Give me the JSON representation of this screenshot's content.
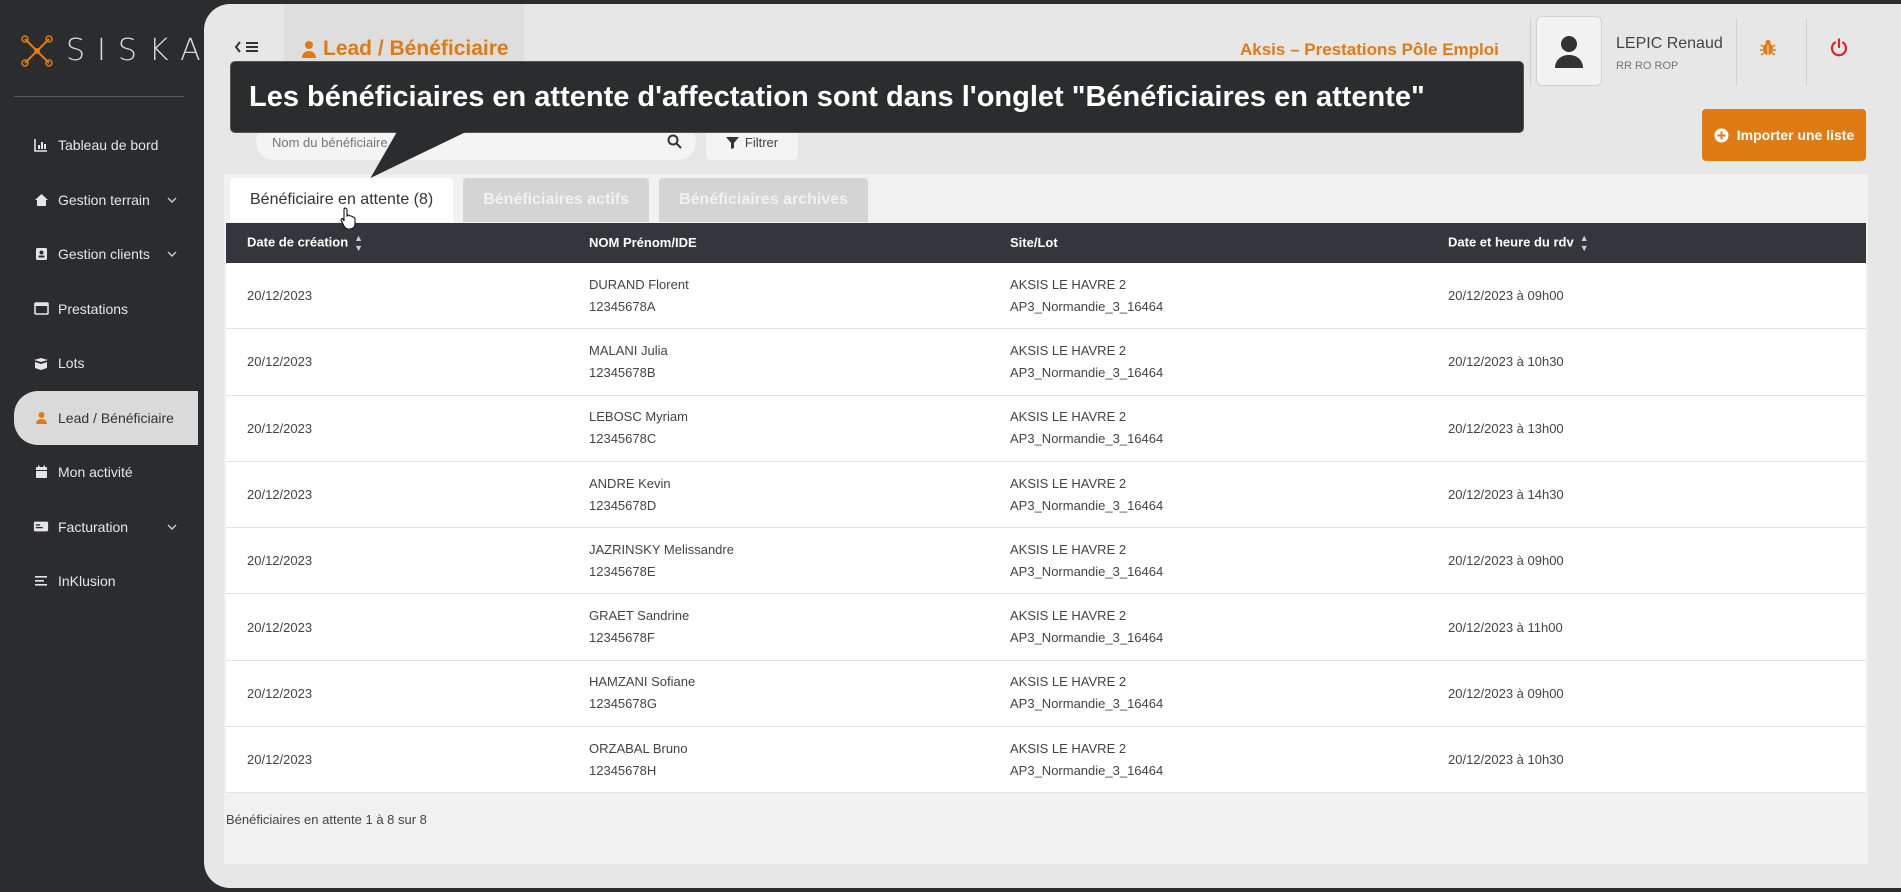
{
  "brand": {
    "name": "SISKA"
  },
  "sidebar": {
    "items": [
      {
        "label": "Tableau de bord",
        "icon": "chart-icon",
        "has_chevron": false
      },
      {
        "label": "Gestion terrain",
        "icon": "home-icon",
        "has_chevron": true
      },
      {
        "label": "Gestion clients",
        "icon": "contact-book-icon",
        "has_chevron": true
      },
      {
        "label": "Prestations",
        "icon": "window-icon",
        "has_chevron": false
      },
      {
        "label": "Lots",
        "icon": "box-icon",
        "has_chevron": false
      },
      {
        "label": "Lead / Bénéficiaire",
        "icon": "user-icon",
        "has_chevron": false,
        "active": true
      },
      {
        "label": "Mon activité",
        "icon": "calendar-icon",
        "has_chevron": false
      },
      {
        "label": "Facturation",
        "icon": "card-icon",
        "has_chevron": true
      },
      {
        "label": "InKlusion",
        "icon": "list-icon",
        "has_chevron": false
      }
    ]
  },
  "header": {
    "page_title": "Lead / Bénéficiaire",
    "company": "Aksis – Prestations Pôle Emploi",
    "user_name": "LEPIC Renaud",
    "user_role": "RR RO ROP"
  },
  "tooltip": {
    "text": "Les bénéficiaires en attente d'affectation sont dans l'onglet \"Bénéficiaires en attente\""
  },
  "search": {
    "placeholder": "Nom du bénéficiaire..."
  },
  "filter": {
    "label": "Filtrer"
  },
  "import": {
    "label": "Importer une liste"
  },
  "tabs": [
    {
      "label": "Bénéficiaire en attente (8)",
      "active": true
    },
    {
      "label": "Bénéficiaires actifs",
      "active": false
    },
    {
      "label": "Bénéficiaires archives",
      "active": false
    }
  ],
  "table": {
    "columns": [
      "Date de création",
      "NOM Prénom/IDE",
      "Site/Lot",
      "Date et heure du rdv"
    ],
    "rows": [
      {
        "date": "20/12/2023",
        "name": "DURAND Florent",
        "ide": "12345678A",
        "site": "AKSIS LE HAVRE 2",
        "lot": "AP3_Normandie_3_16464",
        "rdv": "20/12/2023 à 09h00"
      },
      {
        "date": "20/12/2023",
        "name": "MALANI Julia",
        "ide": "12345678B",
        "site": "AKSIS LE HAVRE 2",
        "lot": "AP3_Normandie_3_16464",
        "rdv": "20/12/2023 à 10h30"
      },
      {
        "date": "20/12/2023",
        "name": "LEBOSC Myriam",
        "ide": "12345678C",
        "site": "AKSIS LE HAVRE 2",
        "lot": "AP3_Normandie_3_16464",
        "rdv": "20/12/2023 à 13h00"
      },
      {
        "date": "20/12/2023",
        "name": "ANDRE Kevin",
        "ide": "12345678D",
        "site": "AKSIS LE HAVRE 2",
        "lot": "AP3_Normandie_3_16464",
        "rdv": "20/12/2023 à 14h30"
      },
      {
        "date": "20/12/2023",
        "name": "JAZRINSKY Melissandre",
        "ide": "12345678E",
        "site": "AKSIS LE HAVRE 2",
        "lot": "AP3_Normandie_3_16464",
        "rdv": "20/12/2023 à 09h00"
      },
      {
        "date": "20/12/2023",
        "name": "GRAET Sandrine",
        "ide": "12345678F",
        "site": "AKSIS LE HAVRE 2",
        "lot": "AP3_Normandie_3_16464",
        "rdv": "20/12/2023 à 11h00"
      },
      {
        "date": "20/12/2023",
        "name": "HAMZANI Sofiane",
        "ide": "12345678G",
        "site": "AKSIS LE HAVRE 2",
        "lot": "AP3_Normandie_3_16464",
        "rdv": "20/12/2023 à 09h00"
      },
      {
        "date": "20/12/2023",
        "name": "ORZABAL Bruno",
        "ide": "12345678H",
        "site": "AKSIS LE HAVRE 2",
        "lot": "AP3_Normandie_3_16464",
        "rdv": "20/12/2023 à 10h30"
      }
    ]
  },
  "footer": {
    "text": "Bénéficiaires en attente 1 à 8 sur 8"
  },
  "colors": {
    "accent": "#e07b14",
    "sidebar": "#2b2c2e",
    "table_header": "#33373b"
  }
}
